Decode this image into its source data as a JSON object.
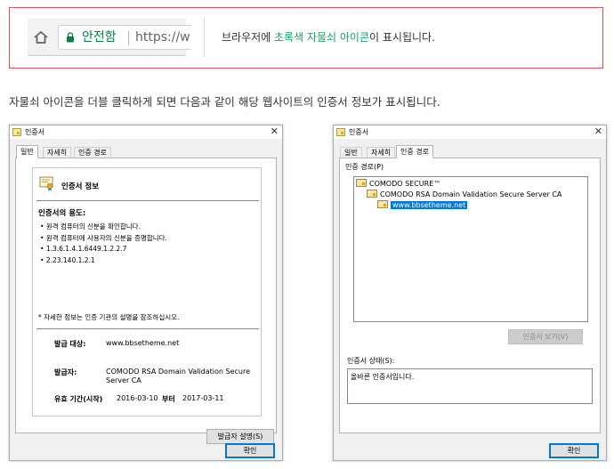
{
  "callout": {
    "secure_label": "안전함",
    "url_text": "https://w",
    "text_before": "브라우저에 ",
    "text_green": "초록색 자물쇠 아이콘",
    "text_after": "이 표시됩니다.",
    "accent_green": "#19a15f",
    "border_color": "#d9534f"
  },
  "caption": "자물쇠 아이콘을 더블 클릭하게 되면 다음과 같이 해당 웹사이트의 인증서 정보가 표시됩니다.",
  "dialog_left": {
    "title": "인증서",
    "tabs": [
      "일반",
      "자세히",
      "인증 경로"
    ],
    "active_tab": "일반",
    "info_title": "인증서 정보",
    "purpose_title": "인증서의 용도:",
    "purposes": [
      "원격 컴퓨터의 신분을 확인합니다.",
      "원격 컴퓨터에 사용자의 신분을 증명합니다.",
      "1.3.6.1.4.1.6449.1.2.2.7",
      "2.23.140.1.2.1"
    ],
    "note": "* 자세한 정보는 인증 기관의 설명을 참조하십시오.",
    "issued_to_label": "발급 대상:",
    "issued_to": "www.bbsetheme.net",
    "issued_by_label": "발급자:",
    "issued_by": "COMODO RSA Domain Validation Secure Server CA",
    "validity_label": "유효 기간(시작)",
    "valid_from": "2016-03-10",
    "to_label": "부터",
    "valid_to": "2017-03-11",
    "issuer_stmt_button": "발급자 설명(S)",
    "ok_button": "확인"
  },
  "dialog_right": {
    "title": "인증서",
    "tabs": [
      "일반",
      "자세히",
      "인증 경로"
    ],
    "active_tab": "인증 경로",
    "path_label": "인증 경로(P)",
    "path_nodes": [
      "COMODO SECURE™",
      "COMODO RSA Domain Validation Secure Server CA",
      "www.bbsetheme.net"
    ],
    "view_cert_button": "인증서 보기(V)",
    "status_label": "인증서 상태(S):",
    "status_text": "올바른 인증서입니다.",
    "ok_button": "확인"
  }
}
